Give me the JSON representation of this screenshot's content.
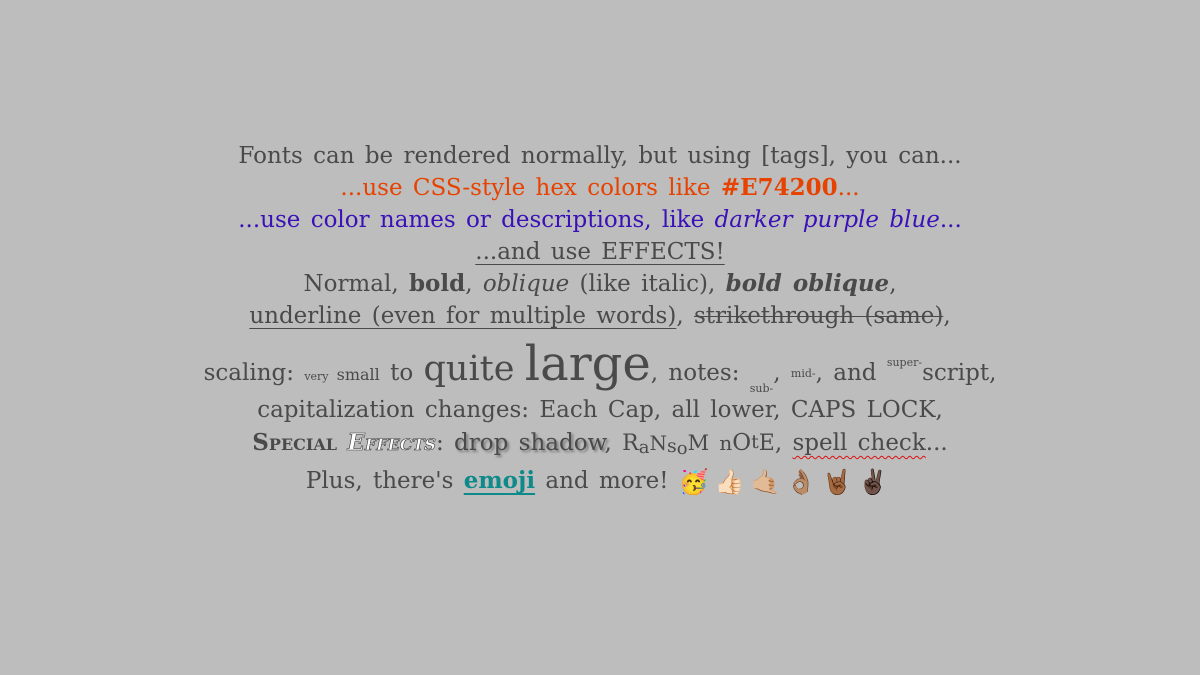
{
  "line1": "Fonts can be rendered normally, but using [tags], you can...",
  "line2": {
    "pre": "...use CSS-style hex colors like ",
    "hex": "#E74200",
    "post": "..."
  },
  "line3": {
    "pre": "...use color names or descriptions, like ",
    "italic": "darker purple blue",
    "post": "..."
  },
  "line4": "...and use EFFECTS!",
  "line5": {
    "normal": "Normal, ",
    "bold": "bold",
    "c1": ", ",
    "oblique": "oblique",
    "like": " (like italic), ",
    "boldoblique": "bold oblique",
    "c2": ","
  },
  "line6": {
    "underline": "underline (even for multiple words)",
    "c1": ", ",
    "strike": "strikethrough (same)",
    "c2": ","
  },
  "line7": {
    "scaling": "scaling: ",
    "very": "very",
    "small": " small",
    "to": " to ",
    "quite": "quite",
    "large": "large",
    "notes": ", notes: ",
    "sub": "sub-",
    "c1": ", ",
    "mid": "mid-",
    "and": ", and ",
    "super": "super-",
    "script": "script,"
  },
  "line8": "capitalization changes: Each Cap, all lower, CAPS LOCK,",
  "line9": {
    "special": "Special",
    "effects": "Effects",
    "colon": ": ",
    "shadow": "drop shadow",
    "c1": ", ",
    "ransom": [
      "R",
      "a",
      "N",
      "s",
      "o",
      "M",
      " ",
      "n",
      "O",
      "t",
      "E"
    ],
    "c2": ", ",
    "spell": "spell check",
    "post": "..."
  },
  "line10": {
    "pre": "Plus, there's ",
    "emoji": "emoji",
    "post": " and more! ",
    "emojis": "🥳👍🏻🤙🏼👌🏽🤘🏾✌🏿"
  }
}
